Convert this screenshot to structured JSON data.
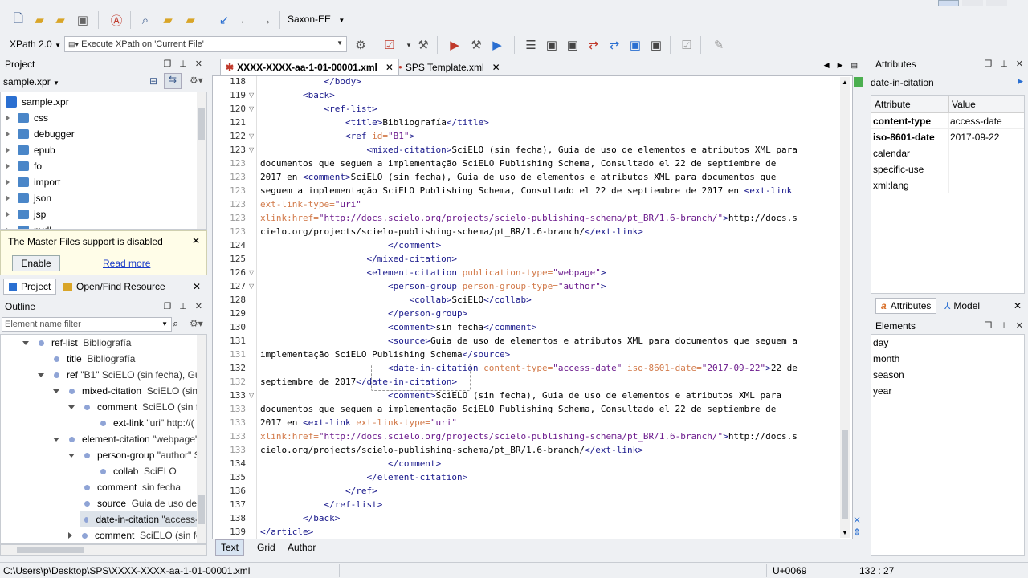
{
  "toolbar1": {
    "processor": "Saxon-EE"
  },
  "toolbar2": {
    "xpath_version": "XPath 2.0",
    "xpath_placeholder": "Execute XPath on  'Current File'"
  },
  "project": {
    "title": "Project",
    "file": "sample.xpr",
    "root": "sample.xpr",
    "folders": [
      "css",
      "debugger",
      "epub",
      "fo",
      "import",
      "json",
      "jsp",
      "pvdl"
    ],
    "notice": "The Master Files support is disabled",
    "enable_label": "Enable",
    "read_more_label": "Read more",
    "tab_project": "Project",
    "tab_open_find": "Open/Find Resource"
  },
  "outline": {
    "title": "Outline",
    "filter_placeholder": "Element name filter",
    "rows": [
      {
        "name": "ref-list",
        "detail": "Bibliografía"
      },
      {
        "name": "title",
        "detail": "Bibliografía"
      },
      {
        "name": "ref",
        "detail": "\"B1\" SciELO (sin fecha), Guia"
      },
      {
        "name": "mixed-citation",
        "detail": "SciELO (sin f"
      },
      {
        "name": "comment",
        "detail": "SciELO (sin fe"
      },
      {
        "name": "ext-link",
        "detail": "\"uri\" http://("
      },
      {
        "name": "element-citation",
        "detail": "\"webpage\""
      },
      {
        "name": "person-group",
        "detail": "\"author\" S"
      },
      {
        "name": "collab",
        "detail": "SciELO"
      },
      {
        "name": "comment",
        "detail": "sin fecha"
      },
      {
        "name": "source",
        "detail": "Guia de uso de e"
      },
      {
        "name": "date-in-citation",
        "detail": "\"access-"
      },
      {
        "name": "comment",
        "detail": "SciELO (sin fe"
      }
    ]
  },
  "editor": {
    "tabs": [
      {
        "label": "XXXX-XXXX-aa-1-01-00001.xml",
        "active": true
      },
      {
        "label": "SPS Template.xml",
        "active": false
      }
    ],
    "bottom_tabs": [
      "Text",
      "Grid",
      "Author"
    ],
    "lines": [
      {
        "n": "118",
        "t": "            </body>"
      },
      {
        "n": "119",
        "t": "        <back>"
      },
      {
        "n": "120",
        "t": "            <ref-list>"
      },
      {
        "n": "121",
        "t": "                <title>Bibliografía</title>"
      },
      {
        "n": "122",
        "t": "                <ref id=\"B1\">"
      },
      {
        "n": "123",
        "t": "                    <mixed-citation>SciELO (sin fecha), Guia de uso de elementos e atributos XML para"
      },
      {
        "n": "123",
        "t": "documentos que seguem a implementação SciELO Publishing Schema, Consultado el 22 de septiembre de"
      },
      {
        "n": "123",
        "t": "2017 en <comment>SciELO (sin fecha), Guia de uso de elementos e atributos XML para documentos que"
      },
      {
        "n": "123",
        "t": "seguem a implementação SciELO Publishing Schema, Consultado el 22 de septiembre de 2017 en <ext-link"
      },
      {
        "n": "123",
        "t": "ext-link-type=\"uri\""
      },
      {
        "n": "123",
        "t": "xlink:href=\"http://docs.scielo.org/projects/scielo-publishing-schema/pt_BR/1.6-branch/\">http://docs.s"
      },
      {
        "n": "123",
        "t": "cielo.org/projects/scielo-publishing-schema/pt_BR/1.6-branch/</ext-link>"
      },
      {
        "n": "124",
        "t": "                        </comment>"
      },
      {
        "n": "125",
        "t": "                    </mixed-citation>"
      },
      {
        "n": "126",
        "t": "                    <element-citation publication-type=\"webpage\">"
      },
      {
        "n": "127",
        "t": "                        <person-group person-group-type=\"author\">"
      },
      {
        "n": "128",
        "t": "                            <collab>SciELO</collab>"
      },
      {
        "n": "129",
        "t": "                        </person-group>"
      },
      {
        "n": "130",
        "t": "                        <comment>sin fecha</comment>"
      },
      {
        "n": "131",
        "t": "                        <source>Guia de uso de elementos e atributos XML para documentos que seguem a"
      },
      {
        "n": "131",
        "t": "implementação SciELO Publishing Schema</source>"
      },
      {
        "n": "132",
        "t": "                        <date-in-citation content-type=\"access-date\" iso-8601-date=\"2017-09-22\">22 de"
      },
      {
        "n": "132",
        "t": "septiembre de 2017</date-in-citation>"
      },
      {
        "n": "133",
        "t": "                        <comment>SciELO (sin fecha), Guia de uso de elementos e atributos XML para"
      },
      {
        "n": "133",
        "t": "documentos que seguem a implementação SciELO Publishing Schema, Consultado el 22 de septiembre de"
      },
      {
        "n": "133",
        "t": "2017 en <ext-link ext-link-type=\"uri\""
      },
      {
        "n": "133",
        "t": "xlink:href=\"http://docs.scielo.org/projects/scielo-publishing-schema/pt_BR/1.6-branch/\">http://docs.s"
      },
      {
        "n": "133",
        "t": "cielo.org/projects/scielo-publishing-schema/pt_BR/1.6-branch/</ext-link>"
      },
      {
        "n": "134",
        "t": "                        </comment>"
      },
      {
        "n": "135",
        "t": "                    </element-citation>"
      },
      {
        "n": "136",
        "t": "                </ref>"
      },
      {
        "n": "137",
        "t": "            </ref-list>"
      },
      {
        "n": "138",
        "t": "        </back>"
      },
      {
        "n": "139",
        "t": "</article>"
      }
    ]
  },
  "attributes": {
    "title": "Attributes",
    "element": "date-in-citation",
    "col_attr": "Attribute",
    "col_value": "Value",
    "rows": [
      {
        "name": "content-type",
        "value": "access-date",
        "bold": true
      },
      {
        "name": "iso-8601-date",
        "value": "2017-09-22",
        "bold": true
      },
      {
        "name": "calendar",
        "value": "",
        "bold": false
      },
      {
        "name": "specific-use",
        "value": "",
        "bold": false
      },
      {
        "name": "xml:lang",
        "value": "",
        "bold": false
      }
    ],
    "tab_attributes": "Attributes",
    "tab_model": "Model"
  },
  "elements": {
    "title": "Elements",
    "items": [
      "day",
      "month",
      "season",
      "year"
    ]
  },
  "status": {
    "path": "C:\\Users\\p\\Desktop\\SPS\\XXXX-XXXX-aa-1-01-00001.xml",
    "unicode": "U+0069",
    "position": "132 : 27"
  }
}
